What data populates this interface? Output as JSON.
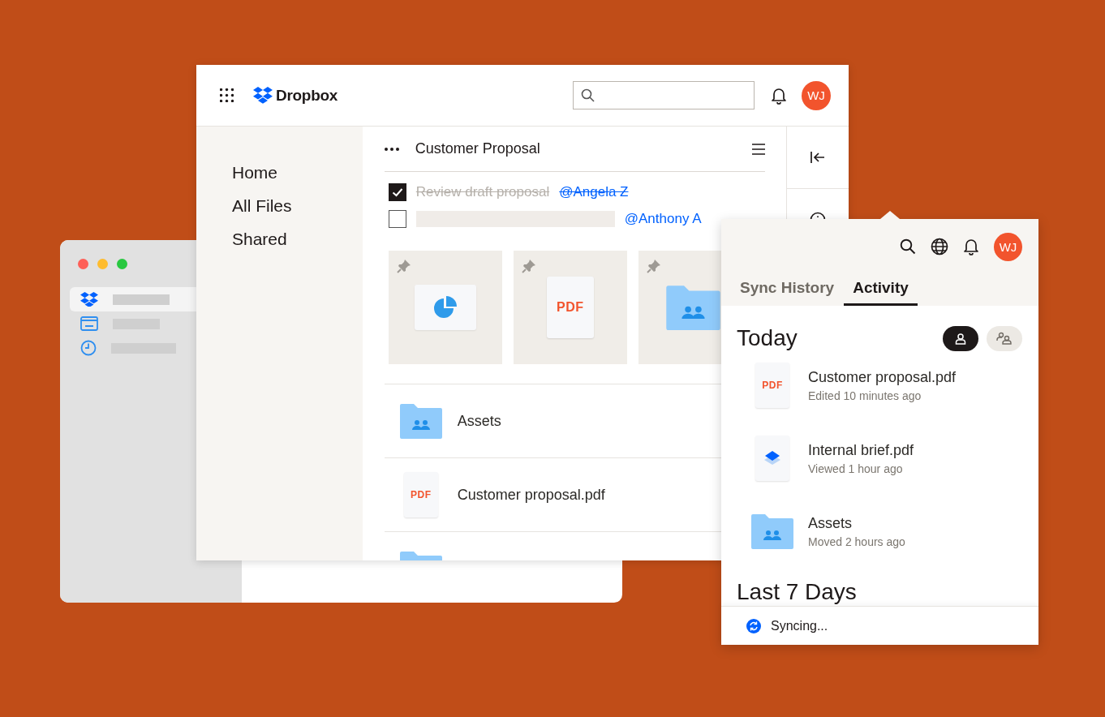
{
  "back_window": {
    "sidebar": [
      {
        "kind": "dropbox",
        "selected": true
      },
      {
        "kind": "card",
        "selected": false
      },
      {
        "kind": "clock",
        "selected": false
      }
    ]
  },
  "app": {
    "logo": "Dropbox",
    "avatar": "WJ",
    "nav": [
      {
        "label": "Home"
      },
      {
        "label": "All Files"
      },
      {
        "label": "Shared"
      }
    ],
    "doc_title": "Customer Proposal",
    "tasks": [
      {
        "text": "Review draft proposal",
        "mention": "@Angela Z",
        "checked": true
      },
      {
        "mention": "@Anthony A",
        "checked": false
      }
    ],
    "pinned": [
      {
        "kind": "chart"
      },
      {
        "kind": "pdf",
        "badge": "PDF"
      },
      {
        "kind": "folder"
      }
    ],
    "files": [
      {
        "kind": "folder",
        "name": "Assets"
      },
      {
        "kind": "pdf",
        "badge": "PDF",
        "name": "Customer proposal.pdf"
      },
      {
        "kind": "folder"
      }
    ]
  },
  "panel": {
    "avatar": "WJ",
    "tabs": [
      {
        "label": "Sync History",
        "selected": false
      },
      {
        "label": "Activity",
        "selected": true
      }
    ],
    "heading": "Today",
    "filters": [
      {
        "kind": "person",
        "selected": true
      },
      {
        "kind": "people",
        "selected": false
      }
    ],
    "items": [
      {
        "kind": "pdf",
        "badge": "PDF",
        "name": "Customer proposal.pdf",
        "detail": "Edited 10 minutes ago"
      },
      {
        "kind": "paper",
        "name": "Internal brief.pdf",
        "detail": "Viewed 1 hour ago"
      },
      {
        "kind": "folder",
        "name": "Assets",
        "detail": "Moved 2 hours ago"
      }
    ],
    "next_heading": "Last 7 Days",
    "status": "Syncing..."
  }
}
